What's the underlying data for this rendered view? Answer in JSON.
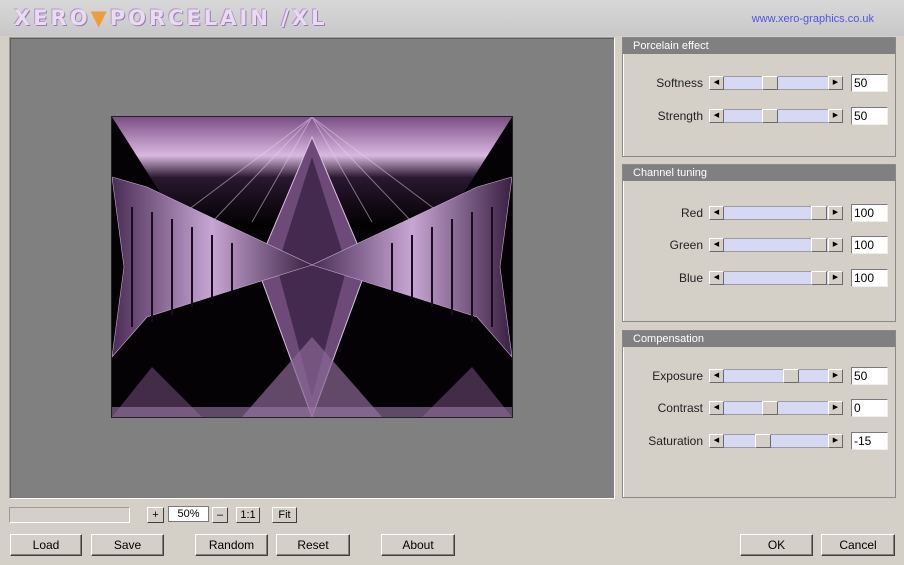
{
  "header": {
    "logo_text_1": "XERO",
    "logo_separator": "▼",
    "logo_text_2": "PORCELAIN /XL",
    "url": "www.xero-graphics.co.uk"
  },
  "panels": {
    "porcelain": {
      "title": "Porcelain effect",
      "sliders": [
        {
          "label": "Softness",
          "value": "50",
          "level": 0.5
        },
        {
          "label": "Strength",
          "value": "50",
          "level": 0.5
        }
      ]
    },
    "channel": {
      "title": "Channel tuning",
      "sliders": [
        {
          "label": "Red",
          "value": "100",
          "level": 1.0
        },
        {
          "label": "Green",
          "value": "100",
          "level": 1.0
        },
        {
          "label": "Blue",
          "value": "100",
          "level": 1.0
        }
      ]
    },
    "compensation": {
      "title": "Compensation",
      "sliders": [
        {
          "label": "Exposure",
          "value": "50",
          "level": 0.75
        },
        {
          "label": "Contrast",
          "value": "0",
          "level": 0.5
        },
        {
          "label": "Saturation",
          "value": "-15",
          "level": 0.425
        }
      ]
    }
  },
  "zoom": {
    "plus": "+",
    "value": "50%",
    "minus": "–",
    "one_to_one": "1:1",
    "fit": "Fit"
  },
  "buttons": {
    "load": "Load",
    "save": "Save",
    "random": "Random",
    "reset": "Reset",
    "about": "About",
    "ok": "OK",
    "cancel": "Cancel"
  },
  "colors": {
    "accent_orange": "#ef9c3c",
    "link_blue": "#5353e8",
    "slider_track": "#d6d8f4",
    "panel_header": "#808080"
  }
}
